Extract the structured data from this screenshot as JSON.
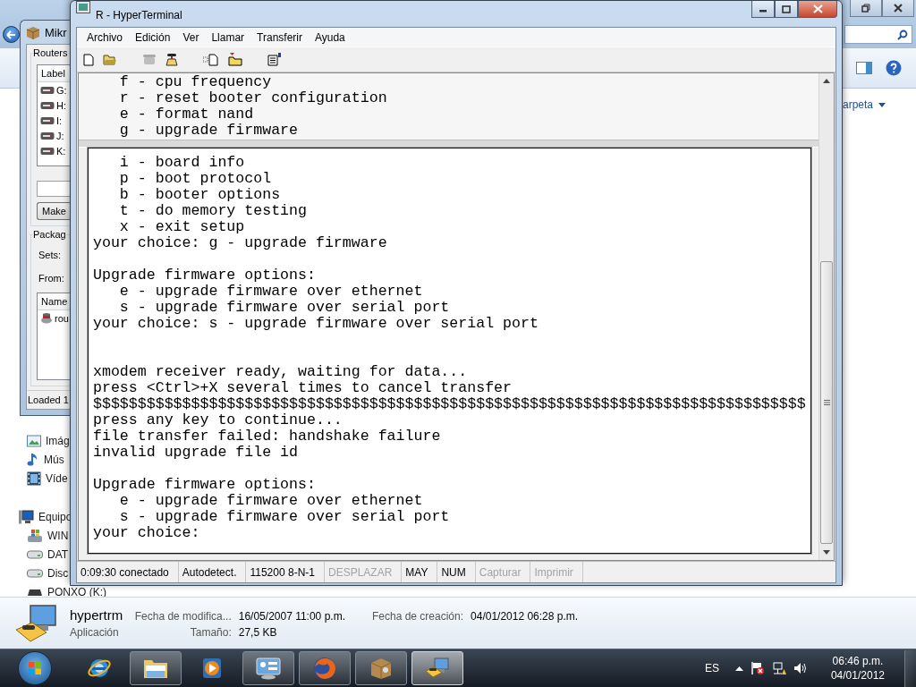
{
  "explorer": {
    "libraries": [
      {
        "label": "Imág",
        "kind": "pictures"
      },
      {
        "label": "Mús",
        "kind": "music"
      },
      {
        "label": "Víde",
        "kind": "videos"
      }
    ],
    "computer": {
      "label": "Equipo",
      "children": [
        {
          "label": "WIN",
          "kind": "system-drive"
        },
        {
          "label": "DAT",
          "kind": "drive"
        },
        {
          "label": "Disc",
          "kind": "drive"
        },
        {
          "label": "PONXO (K:)",
          "kind": "removable"
        }
      ]
    },
    "arrange_by": "arpeta",
    "details": {
      "name": "hypertrm",
      "type": "Aplicación",
      "properties": [
        {
          "label": "Fecha de modifica...",
          "value": "16/05/2007 11:00 p.m."
        },
        {
          "label": "Fecha de creación:",
          "value": "04/01/2012 06:28 p.m."
        },
        {
          "label": "Tamaño:",
          "value": "27,5 KB"
        }
      ]
    }
  },
  "mikrotik_window": {
    "title": "Mikr",
    "routers_group": "Routers",
    "routers_column": "Label",
    "routers": [
      "G:",
      "H:",
      "I:",
      "J:",
      "K:"
    ],
    "make_button": "Make",
    "packages_group": "Packag",
    "fields": [
      "Sets:",
      "From:"
    ],
    "packages_column": "Name",
    "packages": [
      "rou"
    ],
    "status": "Loaded 1"
  },
  "terminal_window": {
    "title": "R - HyperTerminal",
    "menu": [
      "Archivo",
      "Edición",
      "Ver",
      "Llamar",
      "Transferir",
      "Ayuda"
    ],
    "upper_pane_lines": [
      "   f - cpu frequency",
      "   r - reset booter configuration",
      "   e - format nand",
      "   g - upgrade firmware"
    ],
    "lower_pane_lines": [
      {
        "kind": "text",
        "text": "   i - board info"
      },
      {
        "kind": "text",
        "text": "   p - boot protocol"
      },
      {
        "kind": "text",
        "text": "   b - booter options"
      },
      {
        "kind": "text",
        "text": "   t - do memory testing"
      },
      {
        "kind": "text",
        "text": "   x - exit setup"
      },
      {
        "kind": "text",
        "text": "your choice: g - upgrade firmware"
      },
      {
        "kind": "blank"
      },
      {
        "kind": "text",
        "text": "Upgrade firmware options:"
      },
      {
        "kind": "text",
        "text": "   e - upgrade firmware over ethernet"
      },
      {
        "kind": "text",
        "text": "   s - upgrade firmware over serial port"
      },
      {
        "kind": "text",
        "text": "your choice: s - upgrade firmware over serial port"
      },
      {
        "kind": "blank"
      },
      {
        "kind": "blank"
      },
      {
        "kind": "text",
        "text": "xmodem receiver ready, waiting for data..."
      },
      {
        "kind": "text",
        "text": "press <Ctrl>+X several times to cancel transfer"
      },
      {
        "kind": "text",
        "text": "$$$$$$$$$$$$$$$$$$$$$$$$$$$$$$$$$$$$$$$$$$$$$$$$$$$$$$$$$$$$$$$$$$$$$$$$$$$$$$$$"
      },
      {
        "kind": "text",
        "text": "press any key to continue..."
      },
      {
        "kind": "text",
        "text": "file transfer failed: handshake failure"
      },
      {
        "kind": "text",
        "text": "invalid upgrade file id"
      },
      {
        "kind": "blank"
      },
      {
        "kind": "text",
        "text": "Upgrade firmware options:"
      },
      {
        "kind": "text",
        "text": "   e - upgrade firmware over ethernet"
      },
      {
        "kind": "text",
        "text": "   s - upgrade firmware over serial port"
      },
      {
        "kind": "text",
        "text": "your choice:"
      }
    ],
    "status_bar": [
      {
        "text": "0:09:30 conectado",
        "disabled": false
      },
      {
        "text": "Autodetect.",
        "disabled": false
      },
      {
        "text": "115200 8-N-1",
        "disabled": false
      },
      {
        "text": "DESPLAZAR",
        "disabled": true
      },
      {
        "text": "MAY",
        "disabled": false
      },
      {
        "text": "NUM",
        "disabled": false
      },
      {
        "text": "Capturar",
        "disabled": true
      },
      {
        "text": "Imprimir",
        "disabled": true
      }
    ]
  },
  "taskbar": {
    "apps": [
      {
        "kind": "ie",
        "running": false,
        "active": false
      },
      {
        "kind": "explorer",
        "running": true,
        "active": false
      },
      {
        "kind": "media",
        "running": false,
        "active": false
      },
      {
        "kind": "control",
        "running": true,
        "active": false
      },
      {
        "kind": "firefox",
        "running": true,
        "active": false
      },
      {
        "kind": "box",
        "running": true,
        "active": false
      },
      {
        "kind": "hyperterminal",
        "running": true,
        "active": true
      }
    ],
    "language": "ES",
    "time": "06:46 p.m.",
    "date": "04/01/2012"
  }
}
